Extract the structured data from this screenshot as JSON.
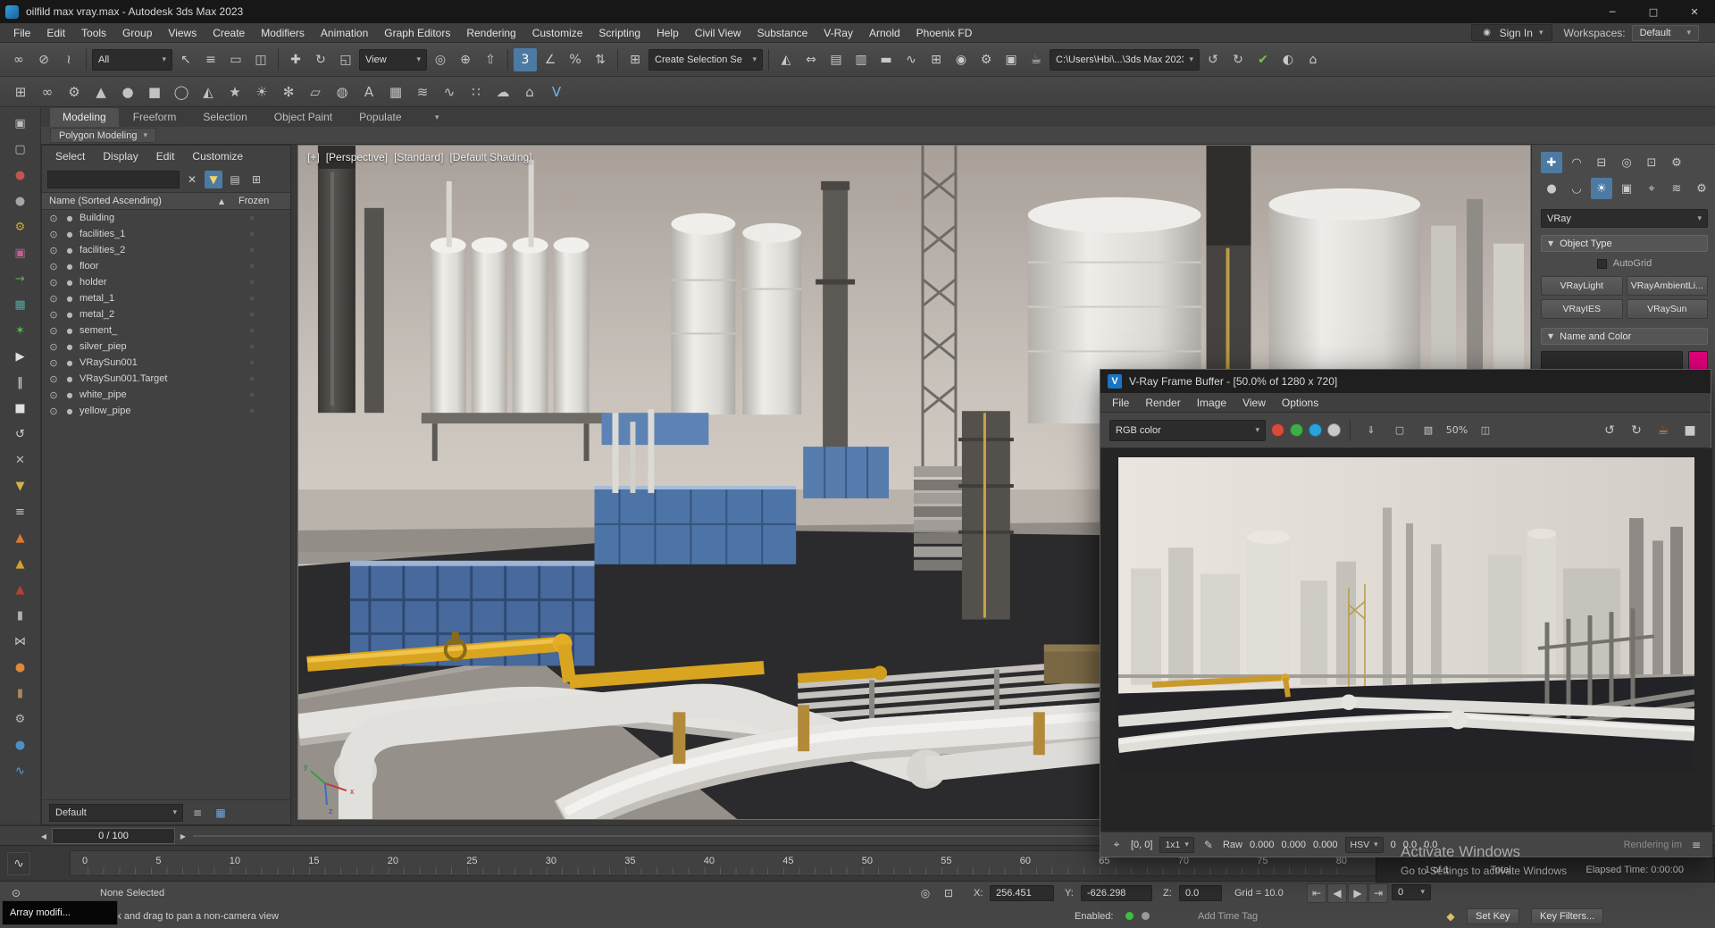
{
  "glyphs": {
    "caret": "▾",
    "caret_up": "▴",
    "sort_asc": "▲",
    "close": "✕",
    "arrow_left": "◀",
    "arrow_right": "▶"
  },
  "colors": {
    "accent_blue": "#4d7aa3",
    "swatch_magenta": "#e2007a",
    "enabled_green": "#3fbf3f",
    "enabled_gray": "#9a9a9a",
    "vfb_red": "#d94a3d",
    "vfb_green": "#3fae49",
    "vfb_blue": "#2aa3dd",
    "vfb_mono": "#c9c9c9",
    "check_green": "#7bc24f"
  },
  "titlebar": {
    "title": "oilfild max vray.max - Autodesk 3ds Max 2023",
    "controls": [
      {
        "name": "minimize-button",
        "glyph": "─"
      },
      {
        "name": "maximize-button",
        "glyph": "□"
      },
      {
        "name": "close-button",
        "glyph": "✕"
      }
    ]
  },
  "menubar": {
    "items": [
      "File",
      "Edit",
      "Tools",
      "Group",
      "Views",
      "Create",
      "Modifiers",
      "Animation",
      "Graph Editors",
      "Rendering",
      "Customize",
      "Scripting",
      "Help",
      "Civil View",
      "Substance",
      "V-Ray",
      "Arnold",
      "Phoenix FD"
    ],
    "sign_in": "Sign In",
    "workspaces_label": "Workspaces:",
    "workspaces_value": "Default"
  },
  "toolbar_main": {
    "group_link": [
      {
        "name": "select-and-link-icon",
        "glyph": "∞"
      },
      {
        "name": "unlink-selection-icon",
        "glyph": "⊘"
      },
      {
        "name": "bind-to-space-warp-icon",
        "glyph": "≀"
      }
    ],
    "selection_filter": "All",
    "group_select": [
      {
        "name": "select-object-icon",
        "glyph": "↖"
      },
      {
        "name": "select-by-name-icon",
        "glyph": "≡"
      },
      {
        "name": "rectangular-selection-region-icon",
        "glyph": "▭"
      },
      {
        "name": "window-crossing-icon",
        "glyph": "◫"
      }
    ],
    "group_transform": [
      {
        "name": "select-and-move-icon",
        "glyph": "✚"
      },
      {
        "name": "select-and-rotate-icon",
        "glyph": "↻"
      },
      {
        "name": "select-and-scale-icon",
        "glyph": "◱"
      }
    ],
    "ref_coord": "View",
    "group_pivot": [
      {
        "name": "use-pivot-center-icon",
        "glyph": "◎"
      },
      {
        "name": "select-and-manipulate-icon",
        "glyph": "⊕"
      },
      {
        "name": "keyboard-shortcut-override-icon",
        "glyph": "⇧"
      }
    ],
    "group_snaps": [
      {
        "name": "snaps-toggle-icon",
        "glyph": "3",
        "active": true
      },
      {
        "name": "angle-snap-icon",
        "glyph": "∠"
      },
      {
        "name": "percent-snap-icon",
        "glyph": "%"
      },
      {
        "name": "spinner-snap-icon",
        "glyph": "⇅"
      }
    ],
    "group_sets": [
      {
        "name": "edit-named-selection-sets-icon",
        "glyph": "⊞"
      }
    ],
    "named_selection": "Create Selection Se",
    "group_tools": [
      {
        "name": "mirror-icon",
        "glyph": "◭"
      },
      {
        "name": "align-icon",
        "glyph": "⇔"
      },
      {
        "name": "layer-manager-icon",
        "glyph": "▤"
      },
      {
        "name": "scene-explorer-toggle-icon",
        "glyph": "▥"
      },
      {
        "name": "ribbon-toggle-icon",
        "glyph": "▬"
      },
      {
        "name": "curve-editor-icon",
        "glyph": "∿"
      },
      {
        "name": "schematic-view-icon",
        "glyph": "⊞"
      },
      {
        "name": "material-editor-icon",
        "glyph": "◉"
      },
      {
        "name": "render-setup-icon",
        "glyph": "⚙"
      },
      {
        "name": "rendered-frame-window-icon",
        "glyph": "▣"
      },
      {
        "name": "render-production-icon",
        "glyph": "☕"
      }
    ],
    "project_path": "C:\\Users\\Hbi\\...\\3ds Max 2023",
    "group_right": [
      {
        "name": "undo-view-icon",
        "glyph": "↺"
      },
      {
        "name": "redo-view-icon",
        "glyph": "↻"
      },
      {
        "name": "asset-check-icon",
        "glyph": "✔",
        "color": "#7bc24f"
      },
      {
        "name": "compare-icon",
        "glyph": "◐"
      },
      {
        "name": "home-grid-icon",
        "glyph": "⌂"
      }
    ]
  },
  "toolbar_extra": {
    "icons": [
      {
        "name": "containers-icon",
        "glyph": "⊞"
      },
      {
        "name": "chain-link-icon",
        "glyph": "∞"
      },
      {
        "name": "gear-tool-icon",
        "glyph": "⚙"
      },
      {
        "name": "cone-primitive-icon",
        "glyph": "▲"
      },
      {
        "name": "sphere-primitive-icon",
        "glyph": "●"
      },
      {
        "name": "box-primitive-icon",
        "glyph": "■"
      },
      {
        "name": "torus-primitive-icon",
        "glyph": "◯"
      },
      {
        "name": "pyramid-primitive-icon",
        "glyph": "◭"
      },
      {
        "name": "star-shape-icon",
        "glyph": "★"
      },
      {
        "name": "sun-light-icon",
        "glyph": "☀"
      },
      {
        "name": "snowflake-icon",
        "glyph": "✻"
      },
      {
        "name": "plane-primitive-icon",
        "glyph": "▱"
      },
      {
        "name": "geosphere-icon",
        "glyph": "◍"
      },
      {
        "name": "text-shape-icon",
        "glyph": "A"
      },
      {
        "name": "grid-helper-icon",
        "glyph": "▦"
      },
      {
        "name": "wind-warp-icon",
        "glyph": "≋"
      },
      {
        "name": "wave-warp-icon",
        "glyph": "∿"
      },
      {
        "name": "particle-system-icon",
        "glyph": "∷"
      },
      {
        "name": "cloud-icon",
        "glyph": "☁"
      },
      {
        "name": "home-icon",
        "glyph": "⌂"
      },
      {
        "name": "vray-toolbar-icon",
        "glyph": "V",
        "color": "#6fb3e8"
      }
    ]
  },
  "ribbon": {
    "tabs": [
      {
        "label": "Modeling",
        "active": true
      },
      {
        "label": "Freeform"
      },
      {
        "label": "Selection"
      },
      {
        "label": "Object Paint"
      },
      {
        "label": "Populate"
      }
    ],
    "subtab": "Polygon Modeling"
  },
  "dock": {
    "icons": [
      {
        "name": "viewport-layout-a-icon",
        "glyph": "▣",
        "color": "#bdbdbd"
      },
      {
        "name": "viewport-layout-b-icon",
        "glyph": "▢",
        "color": "#bdbdbd"
      },
      {
        "name": "material-red-icon",
        "glyph": "●",
        "color": "#c0574e"
      },
      {
        "name": "material-gray-icon",
        "glyph": "●",
        "color": "#a6a6a6"
      },
      {
        "name": "gear-yellow-icon",
        "glyph": "⚙",
        "color": "#c8a83c"
      },
      {
        "name": "magenta-box-icon",
        "glyph": "▣",
        "color": "#bf6292"
      },
      {
        "name": "green-arrow-icon",
        "glyph": "→",
        "color": "#6aa84f"
      },
      {
        "name": "teal-grid-icon",
        "glyph": "▦",
        "color": "#52a8a0"
      },
      {
        "name": "green-burst-icon",
        "glyph": "✶",
        "color": "#58b858"
      },
      {
        "name": "play-icon",
        "glyph": "▶",
        "color": "#e0e0e0"
      },
      {
        "name": "pause-icon",
        "glyph": "‖",
        "color": "#e0e0e0"
      },
      {
        "name": "stop-icon",
        "glyph": "■",
        "color": "#e0e0e0"
      },
      {
        "name": "loop-icon",
        "glyph": "↺",
        "color": "#d0d0d0"
      },
      {
        "name": "delete-icon",
        "glyph": "✕",
        "color": "#b8b8b8"
      },
      {
        "name": "funnel-filter-icon",
        "glyph": "▼",
        "color": "#d4b44a"
      },
      {
        "name": "list-lines-icon",
        "glyph": "≡",
        "color": "#c8c8c8"
      },
      {
        "name": "flame-orange-icon",
        "glyph": "▲",
        "color": "#e07830"
      },
      {
        "name": "flame-yellow-icon",
        "glyph": "▲",
        "color": "#d8a030"
      },
      {
        "name": "flame-red-icon",
        "glyph": "▲",
        "color": "#b84030"
      },
      {
        "name": "cylinder-icon",
        "glyph": "▮",
        "color": "#b0b0b0"
      },
      {
        "name": "bone-icon",
        "glyph": "⋈",
        "color": "#c8c8c8"
      },
      {
        "name": "orange-ball-icon",
        "glyph": "●",
        "color": "#e08838"
      },
      {
        "name": "barrel-icon",
        "glyph": "▮",
        "color": "#a8885a"
      },
      {
        "name": "wrench-gear-icon",
        "glyph": "⚙",
        "color": "#b8b8b8"
      },
      {
        "name": "blue-ball-icon",
        "glyph": "●",
        "color": "#4a90c8"
      },
      {
        "name": "wave-blue-icon",
        "glyph": "∿",
        "color": "#58a0d8"
      }
    ]
  },
  "scene_explorer": {
    "menus": [
      "Select",
      "Display",
      "Edit",
      "Customize"
    ],
    "search": {
      "clear_glyph": "✕",
      "funnel_glyph": "▼",
      "column_glyph": "▤",
      "settings_glyph": "⊞"
    },
    "columns": {
      "name": "Name (Sorted Ascending)",
      "frozen": "Frozen"
    },
    "row_icons": {
      "eye": "⊙",
      "type": "●",
      "frozen": "◦"
    },
    "rows": [
      "Building",
      "facilities_1",
      "facilities_2",
      "floor",
      "holder",
      "metal_1",
      "metal_2",
      "sement_",
      "silver_piep",
      "VRaySun001",
      "VRaySun001.Target",
      "white_pipe",
      "yellow_pipe"
    ],
    "footer_value": "Default",
    "footer_icons": [
      {
        "name": "layer-stack-icon",
        "glyph": "≡",
        "color": "#c0c0c0"
      },
      {
        "name": "grid-view-icon",
        "glyph": "▦",
        "color": "#6fa8dc"
      }
    ]
  },
  "viewport": {
    "labels": [
      {
        "name": "viewport-general-menu",
        "text": "[+]"
      },
      {
        "name": "viewport-pov-menu",
        "text": "[Perspective]"
      },
      {
        "name": "viewport-standard-menu",
        "text": "[Standard]"
      },
      {
        "name": "viewport-shading-menu",
        "text": "[Default Shading]"
      }
    ]
  },
  "command_panel": {
    "tabs": [
      {
        "name": "create-panel-icon",
        "glyph": "✚",
        "active": true
      },
      {
        "name": "modify-panel-icon",
        "glyph": "◠"
      },
      {
        "name": "hierarchy-panel-icon",
        "glyph": "⊟"
      },
      {
        "name": "motion-panel-icon",
        "glyph": "◎"
      },
      {
        "name": "display-panel-icon",
        "glyph": "⊡"
      },
      {
        "name": "utilities-panel-icon",
        "glyph": "⚙"
      }
    ],
    "categories": [
      {
        "name": "geometry-category-icon",
        "glyph": "●"
      },
      {
        "name": "shapes-category-icon",
        "glyph": "◡"
      },
      {
        "name": "lights-category-icon",
        "glyph": "☀",
        "active": true
      },
      {
        "name": "cameras-category-icon",
        "glyph": "▣"
      },
      {
        "name": "helpers-category-icon",
        "glyph": "⌖"
      },
      {
        "name": "spacewarps-category-icon",
        "glyph": "≋"
      },
      {
        "name": "systems-category-icon",
        "glyph": "⚙"
      }
    ],
    "dropdown_value": "VRay",
    "rollout_arrow": "▼",
    "rollout_object_type": "Object Type",
    "autogrid_label": "AutoGrid",
    "object_buttons": [
      "VRayLight",
      "VRayAmbientLi...",
      "VRayIES",
      "VRaySun"
    ],
    "rollout_name_color": "Name and Color",
    "swatch_color": "#e2007a"
  },
  "vfb": {
    "title": "V-Ray Frame Buffer - [50.0% of 1280 x 720]",
    "icon_letter": "V",
    "menus": [
      "File",
      "Render",
      "Image",
      "View",
      "Options"
    ],
    "channel_value": "RGB color",
    "channel_circles": [
      {
        "name": "red-channel-icon",
        "color": "#d94a3d"
      },
      {
        "name": "green-channel-icon",
        "color": "#3fae49"
      },
      {
        "name": "blue-channel-icon",
        "color": "#2aa3dd"
      },
      {
        "name": "mono-channel-icon",
        "color": "#c9c9c9"
      }
    ],
    "tools_left": [
      {
        "name": "save-image-icon",
        "glyph": "⇓"
      },
      {
        "name": "clear-image-icon",
        "glyph": "▢"
      },
      {
        "name": "region-render-icon",
        "glyph": "▧"
      },
      {
        "name": "zoom-level-badge",
        "glyph": "50%"
      },
      {
        "name": "fit-to-window-icon",
        "glyph": "◫"
      }
    ],
    "tools_right": [
      {
        "name": "history-back-icon",
        "glyph": "↺"
      },
      {
        "name": "history-forward-icon",
        "glyph": "↻"
      },
      {
        "name": "render-last-icon",
        "glyph": "☕",
        "color": "#e0823a"
      },
      {
        "name": "stop-render-icon",
        "glyph": "■"
      }
    ],
    "status": {
      "probe_glyph": "⌖",
      "coords": "[0, 0]",
      "pixel_ratio": "1x1",
      "pencil_glyph": "✎",
      "raw_label": "Raw",
      "r": "0.000",
      "g": "0.000",
      "b": "0.000",
      "hsv_label": "HSV",
      "h": "0",
      "s": "0.0",
      "v": "0.0",
      "rendering_label": "Rendering im",
      "menu_glyph": "≡"
    }
  },
  "timeline": {
    "slider_value": "0 / 100",
    "mini_curve_glyph": "∿",
    "ticks": [
      "0",
      "5",
      "10",
      "15",
      "20",
      "25",
      "30",
      "35",
      "40",
      "45",
      "50",
      "55",
      "60",
      "65",
      "70",
      "75",
      "80"
    ]
  },
  "status": {
    "selection": "None Selected",
    "prompt": "Click and drag to pan a non-camera view",
    "lock_glyph": "⊙",
    "isolate_glyph": "◎",
    "lock2_glyph": "⊡",
    "x_label": "X:",
    "x_value": "256.451",
    "y_label": "Y:",
    "y_value": "-626.298",
    "z_label": "Z:",
    "z_value": "0.0",
    "grid_label": "Grid = 10.0",
    "playback": [
      {
        "name": "go-to-start-icon",
        "glyph": "⇤"
      },
      {
        "name": "previous-frame-icon",
        "glyph": "◀"
      },
      {
        "name": "play-animation-icon",
        "glyph": "▶"
      },
      {
        "name": "go-to-end-icon",
        "glyph": "⇥"
      }
    ],
    "frame_value": "0",
    "enabled_label": "Enabled:",
    "add_time_tag": "Add Time Tag",
    "key_mode_glyph": "◆",
    "set_key_label": "Set Key",
    "key_filters_label": "Key Filters..."
  },
  "frame_stats": {
    "frames": "1 of 1",
    "total_label": "Total",
    "elapsed": "Elapsed Time: 0:00:00"
  },
  "watermark": {
    "line1": "Activate Windows",
    "line2": "Go to Settings to activate Windows"
  },
  "tooltip": {
    "text": "Array modifi..."
  }
}
